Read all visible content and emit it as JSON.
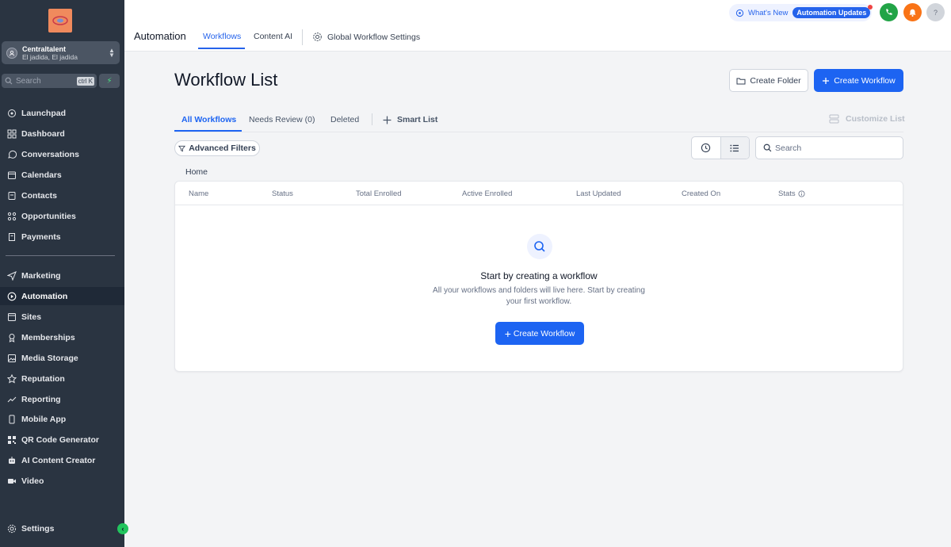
{
  "sidebar": {
    "account": {
      "name": "Centraltalent",
      "location": "El jadida, El jadida"
    },
    "search": {
      "placeholder": "Search",
      "shortcut": "ctrl K"
    },
    "items": [
      {
        "label": "Launchpad",
        "icon": "rocket-icon"
      },
      {
        "label": "Dashboard",
        "icon": "grid-icon"
      },
      {
        "label": "Conversations",
        "icon": "chat-icon"
      },
      {
        "label": "Calendars",
        "icon": "calendar-icon"
      },
      {
        "label": "Contacts",
        "icon": "contacts-icon"
      },
      {
        "label": "Opportunities",
        "icon": "opportunities-icon"
      },
      {
        "label": "Payments",
        "icon": "payments-icon"
      },
      {
        "label": "Marketing",
        "icon": "send-icon"
      },
      {
        "label": "Automation",
        "icon": "automation-icon",
        "active": true
      },
      {
        "label": "Sites",
        "icon": "sites-icon"
      },
      {
        "label": "Memberships",
        "icon": "award-icon"
      },
      {
        "label": "Media Storage",
        "icon": "image-icon"
      },
      {
        "label": "Reputation",
        "icon": "star-icon"
      },
      {
        "label": "Reporting",
        "icon": "trend-icon"
      },
      {
        "label": "Mobile App",
        "icon": "phone-icon"
      },
      {
        "label": "QR Code Generator",
        "icon": "qr-icon"
      },
      {
        "label": "AI Content Creator",
        "icon": "robot-icon"
      },
      {
        "label": "Video",
        "icon": "video-icon"
      },
      {
        "label": "Settings",
        "icon": "gear-icon"
      }
    ]
  },
  "topbar": {
    "title": "Automation",
    "tabs": [
      "Workflows",
      "Content AI",
      "Global Workflow Settings"
    ],
    "whats_new": "What's New",
    "updates_pill": "Automation Updates",
    "help": "?"
  },
  "main": {
    "title": "Workflow List",
    "create_folder": "Create Folder",
    "create_workflow": "Create Workflow",
    "subtabs": [
      "All Workflows",
      "Needs Review (0)",
      "Deleted",
      "Smart List"
    ],
    "customize": "Customize List",
    "advanced_filters": "Advanced Filters",
    "search_placeholder": "Search",
    "breadcrumb": "Home",
    "columns": [
      "Name",
      "Status",
      "Total Enrolled",
      "Active Enrolled",
      "Last Updated",
      "Created On",
      "Stats"
    ],
    "empty_title": "Start by creating a workflow",
    "empty_sub": "All your workflows and folders will live here. Start by creating your first workflow.",
    "empty_button": "Create Workflow"
  },
  "colors": {
    "primary": "#1d64f2",
    "sidebar": "#2a3441",
    "phone": "#22a447",
    "bell": "#f97316"
  }
}
